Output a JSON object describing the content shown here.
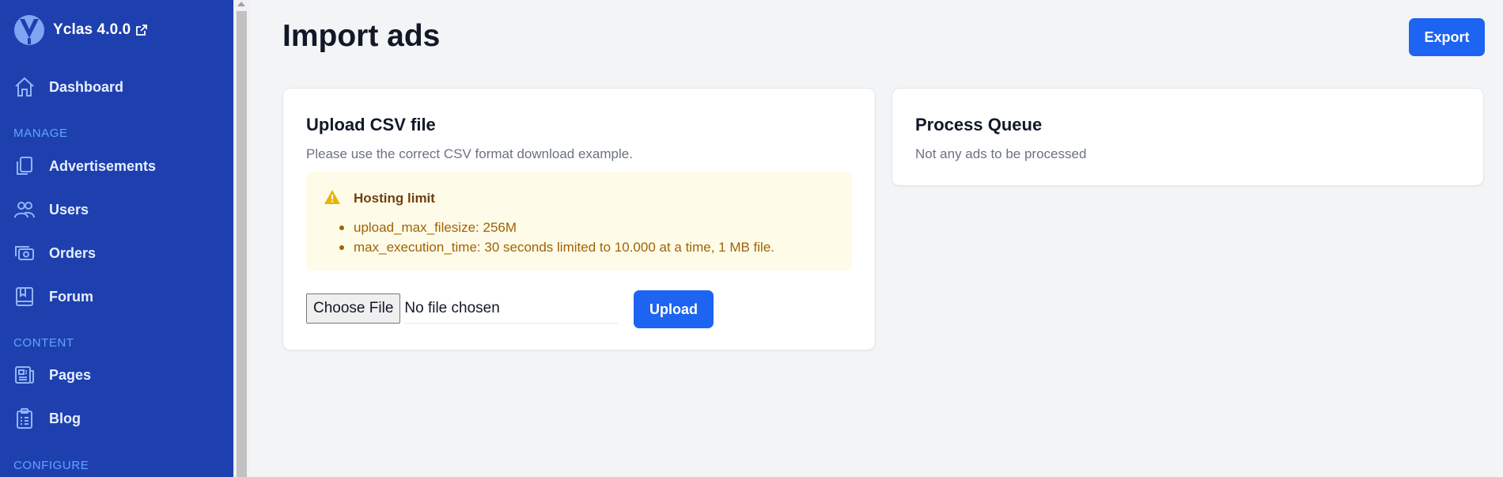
{
  "sidebar": {
    "brand": {
      "title": "Yclas 4.0.0",
      "logo_icon": "yclas-logo",
      "external_icon": "external-link-icon"
    },
    "items": [
      {
        "label": "Dashboard",
        "icon": "home-icon"
      },
      {
        "label": "Advertisements",
        "icon": "documents-icon"
      },
      {
        "label": "Users",
        "icon": "users-icon"
      },
      {
        "label": "Orders",
        "icon": "cash-icon"
      },
      {
        "label": "Forum",
        "icon": "book-icon"
      },
      {
        "label": "Pages",
        "icon": "newspaper-icon"
      },
      {
        "label": "Blog",
        "icon": "clipboard-list-icon"
      }
    ],
    "sections": {
      "manage": "MANAGE",
      "content": "CONTENT",
      "configure": "CONFIGURE"
    }
  },
  "header": {
    "title": "Import ads",
    "export_label": "Export"
  },
  "upload_card": {
    "title": "Upload CSV file",
    "subtitle": "Please use the correct CSV format download example.",
    "warning": {
      "title": "Hosting limit",
      "icon": "warning-icon",
      "items": [
        "upload_max_filesize: 256M",
        "max_execution_time: 30 seconds limited to 10.000 at a time, 1 MB file."
      ]
    },
    "choose_file_label": "Choose File",
    "no_file_text": "No file chosen",
    "upload_label": "Upload"
  },
  "queue_card": {
    "title": "Process Queue",
    "message": "Not any ads to be processed"
  },
  "colors": {
    "sidebar_bg": "#1e40af",
    "primary": "#1d64f2",
    "page_bg": "#f3f4f6",
    "warning_bg": "#fefce8",
    "warning_text": "#a16207"
  }
}
